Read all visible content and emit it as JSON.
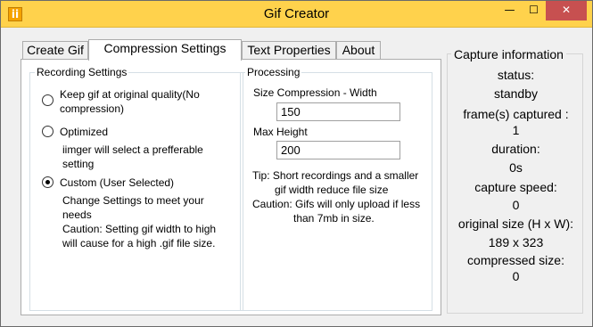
{
  "window": {
    "title": "Gif Creator",
    "icon": "ii",
    "minimize_glyph": "—",
    "maximize_glyph": "☐",
    "close_glyph": "✕"
  },
  "tabs": [
    {
      "label": "Create Gif",
      "active": false
    },
    {
      "label": "Compression Settings",
      "active": true
    },
    {
      "label": "Text Properties",
      "active": false
    },
    {
      "label": "About",
      "active": false
    }
  ],
  "recording": {
    "title": "Recording Settings",
    "options": [
      {
        "label": "Keep gif at original quality(No compression)",
        "selected": false
      },
      {
        "label": "Optimized",
        "selected": false
      },
      {
        "label": "Custom (User Selected)",
        "selected": true
      }
    ],
    "optimized_desc": [
      "iimger will select a prefferable",
      "setting"
    ],
    "custom_desc": [
      "Change Settings to meet your",
      "needs",
      "Caution: Setting gif width to high",
      "will cause for a high .gif file size."
    ]
  },
  "processing": {
    "title": "Processing",
    "width_label": "Size Compression - Width",
    "width_value": "150",
    "height_label": "Max Height",
    "height_value": "200",
    "tip_lines": [
      "Tip: Short recordings and a smaller",
      "gif width reduce file size",
      "Caution: Gifs will only upload if less",
      "than 7mb in size."
    ]
  },
  "capture": {
    "title": "Capture information",
    "status_label": "status:",
    "status_value": "standby",
    "frames_label": "frame(s) captured :",
    "frames_value": "1",
    "duration_label": "duration:",
    "duration_value": "0s",
    "speed_label": "capture speed:",
    "speed_value": "0",
    "original_size_label": "original size (H x W):",
    "original_size_value": "189 x 323",
    "compressed_size_label": "compressed size:",
    "compressed_size_value": "0"
  }
}
